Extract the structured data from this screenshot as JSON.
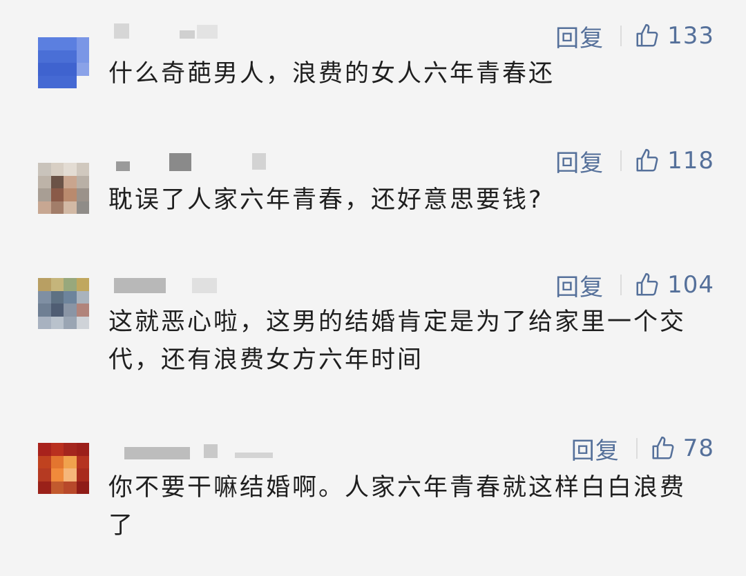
{
  "comments": [
    {
      "reply_label": "回复",
      "like_count": "133",
      "text": "什么奇葩男人，浪费的女人六年青春还",
      "avatar_colors": [
        "#5b7fe0",
        "#5b7fe0",
        "#5b7fe0",
        "#7a96e6",
        "#4a6fd6",
        "#4a6fd6",
        "#4a6fd6",
        "#7a96e6",
        "#3f63cf",
        "#3f63cf",
        "#3f63cf",
        "#8aa2e8",
        "#4569d3",
        "#4569d3",
        "#4569d3",
        "#f4f4f4"
      ]
    },
    {
      "reply_label": "回复",
      "like_count": "118",
      "text": "耽误了人家六年青春，还好意思要钱?",
      "avatar_colors": [
        "#c9c3bb",
        "#d8cfc4",
        "#e3dcd3",
        "#d0c8be",
        "#bdb3a8",
        "#6b5347",
        "#c9a58e",
        "#b9b0a6",
        "#a89e94",
        "#8a5a48",
        "#b98a6e",
        "#9b928a",
        "#c7a792",
        "#a27d69",
        "#d2b9a5",
        "#8f8c88"
      ]
    },
    {
      "reply_label": "回复",
      "like_count": "104",
      "text": "这就恶心啦，这男的结婚肯定是为了给家里一个交代，还有浪费女方六年时间",
      "avatar_colors": [
        "#b89f63",
        "#c5b57b",
        "#98a87c",
        "#c0a75e",
        "#7f8fa3",
        "#5e7183",
        "#6d849c",
        "#a9b3bd",
        "#6f7f93",
        "#4f5d73",
        "#8a95a5",
        "#b1847b",
        "#a8b2c0",
        "#b9c2cc",
        "#9aa5b3",
        "#cfd3d8"
      ]
    },
    {
      "reply_label": "回复",
      "like_count": "78",
      "text": "你不要干嘛结婚啊。人家六年青春就这样白白浪费了",
      "avatar_colors": [
        "#a8221c",
        "#b9301f",
        "#a4261e",
        "#9c1f1a",
        "#c0421f",
        "#e3752f",
        "#f0a24d",
        "#b53320",
        "#b53a22",
        "#f08a3b",
        "#f5b67a",
        "#a82b1d",
        "#9a2119",
        "#c25a2e",
        "#b8492a",
        "#8f1c17"
      ]
    }
  ]
}
